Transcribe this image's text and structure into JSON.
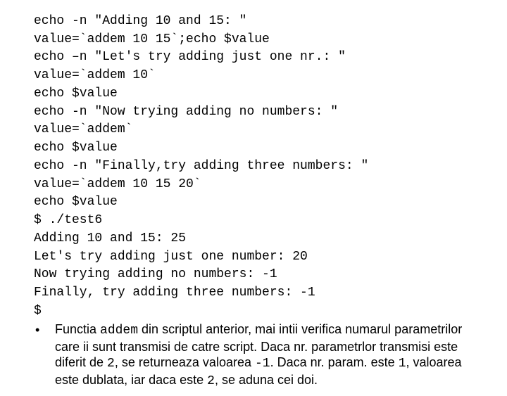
{
  "code": {
    "l1": "echo -n \"Adding 10 and 15: \"",
    "l2": "value=`addem 10 15`;echo $value",
    "l3": "echo –n \"Let's try adding just one nr.: \"",
    "l4": "value=`addem 10`",
    "l5": "echo $value",
    "l6": "echo -n \"Now trying adding no numbers: \"",
    "l7": "value=`addem`",
    "l8": "echo $value",
    "l9": "echo -n \"Finally,try adding three numbers: \"",
    "l10": "value=`addem 10 15 20`",
    "l11": "echo $value",
    "l12": "$ ./test6",
    "l13": "Adding 10 and 15: 25",
    "l14": "Let's try adding just one number: 20",
    "l15": "Now trying adding no numbers: -1",
    "l16": "Finally, try adding three numbers: -1",
    "l17": "$"
  },
  "bullet_glyph": "•",
  "desc": {
    "p1a": "Functia ",
    "p1_mono1": "addem",
    "p1b": " din scriptul anterior, mai intii verifica numarul parametrilor care ii sunt transmisi de catre script. Daca nr. parametrlor transmisi este diferit de ",
    "p1_mono2": "2",
    "p1c": ", se returneaza valoarea ",
    "p1_mono3": "-1",
    "p1d": ". Daca nr. param. este ",
    "p1_mono4": "1",
    "p1e": ", valoarea este dublata, iar daca este ",
    "p1_mono5": "2",
    "p1f": ", se aduna cei doi."
  }
}
